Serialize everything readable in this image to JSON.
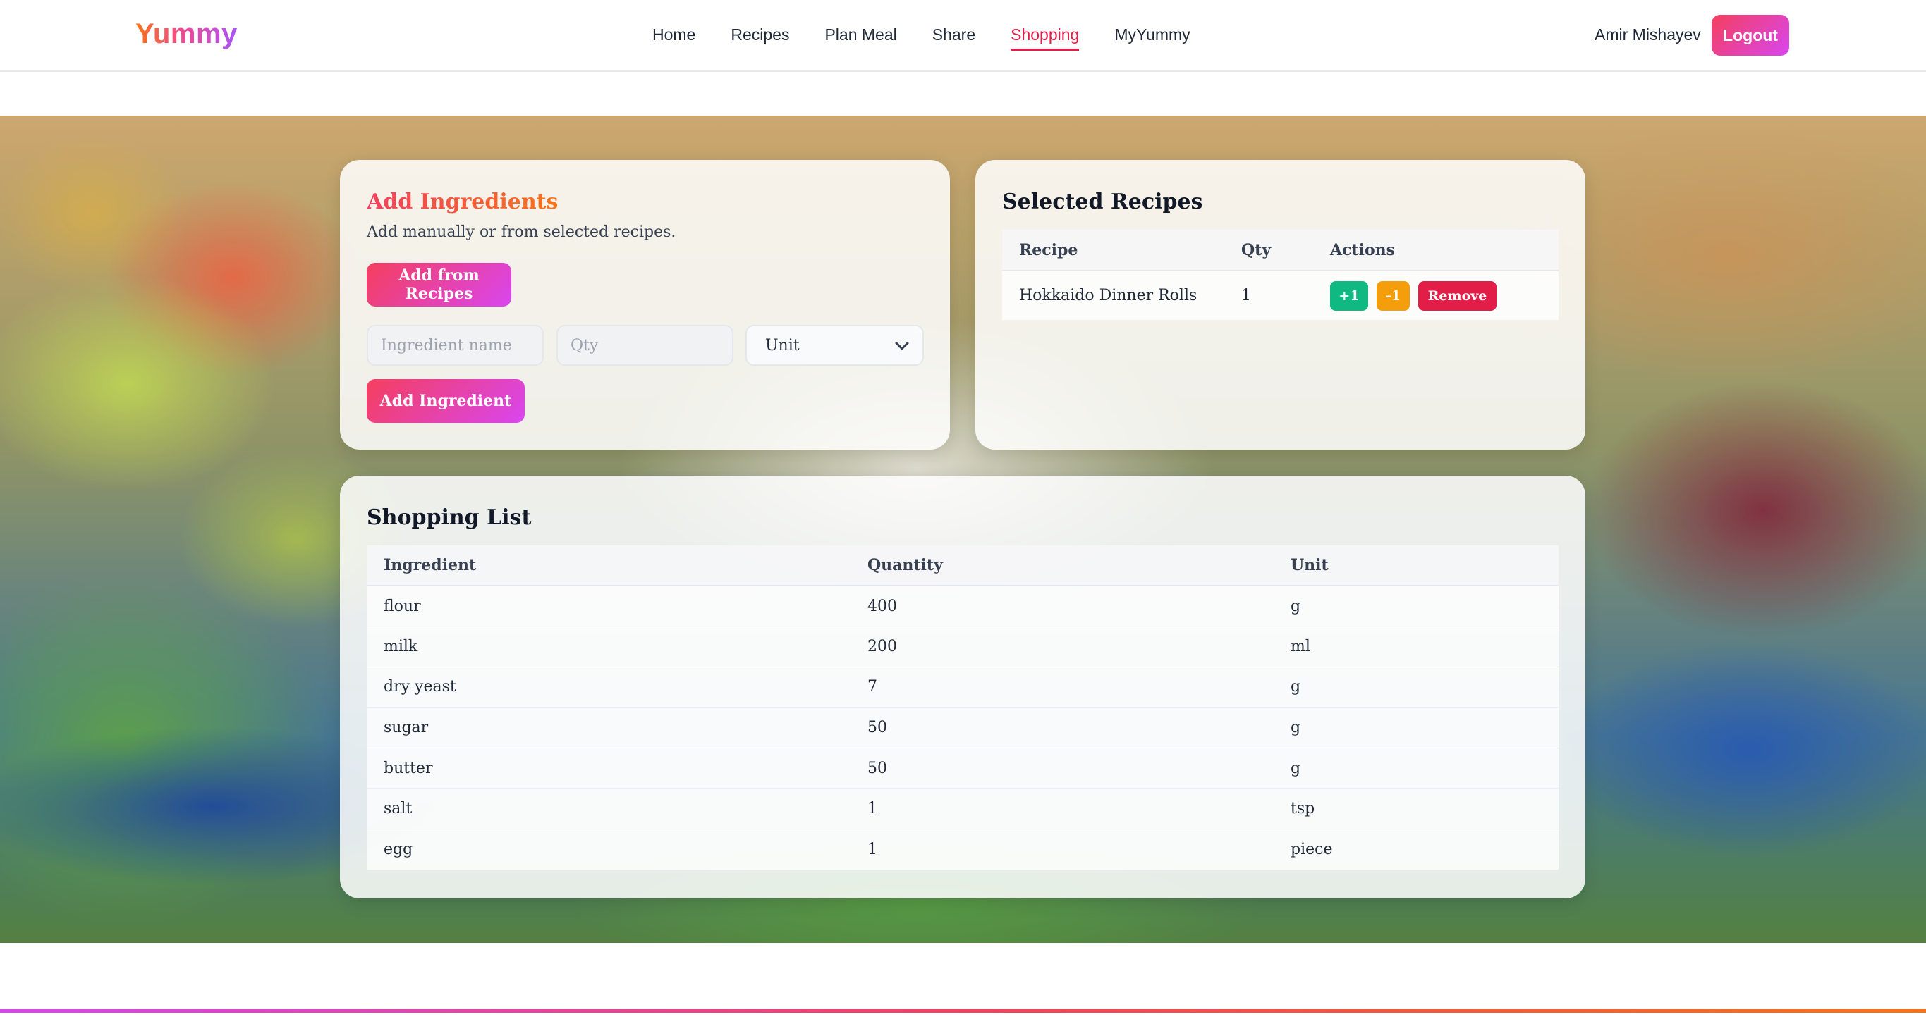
{
  "nav": {
    "logo": "Yummy",
    "links": [
      "Home",
      "Recipes",
      "Plan Meal",
      "Share",
      "Shopping",
      "MyYummy"
    ],
    "active": "Shopping",
    "user_name": "Amir Mishayev",
    "logout_label": "Logout"
  },
  "add_card": {
    "title": "Add Ingredients",
    "subtitle": "Add manually or from selected recipes.",
    "add_from_recipes_label": "Add from Recipes",
    "name_placeholder": "Ingredient name",
    "qty_placeholder": "Qty",
    "unit_value": "Unit",
    "add_ingredient_label": "Add Ingredient"
  },
  "selected": {
    "title": "Selected Recipes",
    "headers": [
      "Recipe",
      "Qty",
      "Actions"
    ],
    "rows": [
      {
        "recipe": "Hokkaido Dinner Rolls",
        "qty": "1",
        "plus": "+1",
        "minus": "-1",
        "remove": "Remove"
      }
    ]
  },
  "shopping": {
    "title": "Shopping List",
    "headers": [
      "Ingredient",
      "Quantity",
      "Unit"
    ],
    "rows": [
      {
        "ingredient": "flour",
        "quantity": "400",
        "unit": "g"
      },
      {
        "ingredient": "milk",
        "quantity": "200",
        "unit": "ml"
      },
      {
        "ingredient": "dry yeast",
        "quantity": "7",
        "unit": "g"
      },
      {
        "ingredient": "sugar",
        "quantity": "50",
        "unit": "g"
      },
      {
        "ingredient": "butter",
        "quantity": "50",
        "unit": "g"
      },
      {
        "ingredient": "salt",
        "quantity": "1",
        "unit": "tsp"
      },
      {
        "ingredient": "egg",
        "quantity": "1",
        "unit": "piece"
      }
    ]
  },
  "colors": {
    "accent": "#e11d48",
    "gradient_start": "#f43f5e",
    "gradient_end": "#d946ef",
    "plus_button": "#10b981",
    "minus_button": "#f59e0b"
  }
}
